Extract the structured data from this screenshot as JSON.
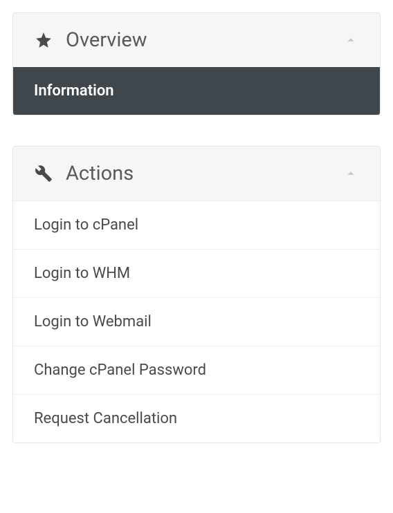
{
  "overview": {
    "title": "Overview",
    "items": [
      {
        "label": "Information",
        "active": true
      }
    ]
  },
  "actions": {
    "title": "Actions",
    "items": [
      {
        "label": "Login to cPanel"
      },
      {
        "label": "Login to WHM"
      },
      {
        "label": "Login to Webmail"
      },
      {
        "label": "Change cPanel Password"
      },
      {
        "label": "Request Cancellation"
      }
    ]
  }
}
